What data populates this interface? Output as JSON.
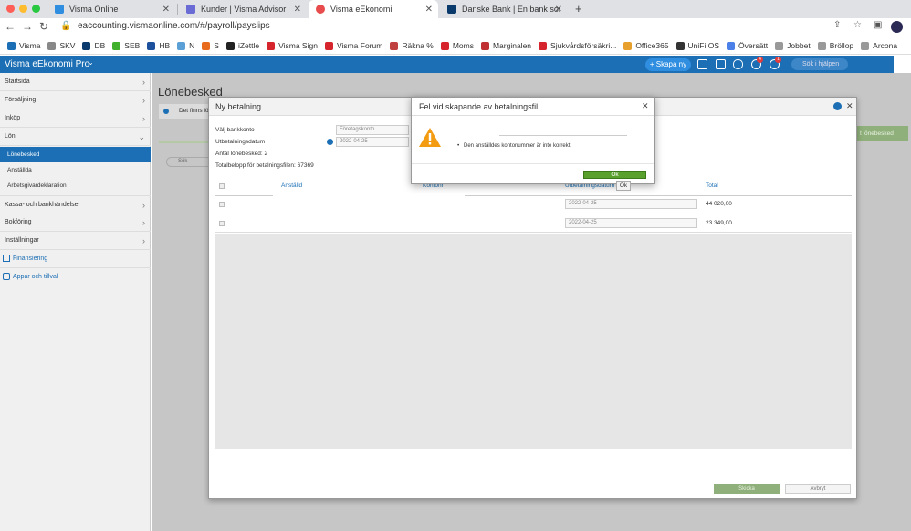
{
  "browser": {
    "tabs": [
      {
        "title": "Visma Online",
        "color": "#2f8ee0"
      },
      {
        "title": "Kunder | Visma Advisor",
        "color": "#6b6bd6"
      },
      {
        "title": "Visma eEkonomi",
        "color": "#e84b4b"
      },
      {
        "title": "Danske Bank | En bank som gö",
        "color": "#0a3a6b"
      }
    ],
    "new_tab": "+",
    "url": "eaccounting.vismaonline.com/#/payroll/payslips",
    "bookmarks": [
      {
        "label": "Visma",
        "color": "#1c6fb4"
      },
      {
        "label": "SKV",
        "color": "#888888"
      },
      {
        "label": "DB",
        "color": "#0a3a6b"
      },
      {
        "label": "SEB",
        "color": "#41b02c"
      },
      {
        "label": "HB",
        "color": "#1c4f9c"
      },
      {
        "label": "N",
        "color": "#5aa0d6"
      },
      {
        "label": "S",
        "color": "#e86b1c"
      },
      {
        "label": "iZettle",
        "color": "#222222"
      },
      {
        "label": "Visma Sign",
        "color": "#d6242c"
      },
      {
        "label": "Visma Forum",
        "color": "#d6242c"
      },
      {
        "label": "Räkna %",
        "color": "#c04040"
      },
      {
        "label": "Moms",
        "color": "#d6242c"
      },
      {
        "label": "Marginalen",
        "color": "#c03030"
      },
      {
        "label": "Sjukvårdsförsäkri...",
        "color": "#d6242c"
      },
      {
        "label": "Office365",
        "color": "#e8a02c"
      },
      {
        "label": "UniFi OS",
        "color": "#333333"
      },
      {
        "label": "Översätt",
        "color": "#4a80e8"
      },
      {
        "label": "Jobbet",
        "color": "#999999"
      },
      {
        "label": "Bröllop",
        "color": "#999999"
      },
      {
        "label": "Arcona",
        "color": "#999999"
      }
    ]
  },
  "app": {
    "brand": "Visma eEkonomi Pro",
    "create_button": "+ Skapa ny",
    "search_placeholder": "Sök i hjälpen",
    "badge_a": "4",
    "badge_b": "1"
  },
  "sidebar": {
    "items": [
      {
        "label": "Startsida"
      },
      {
        "label": "Försäljning"
      },
      {
        "label": "Inköp"
      },
      {
        "label": "Lön"
      }
    ],
    "lon_sub": [
      "Lönebesked",
      "Anställda",
      "Arbetsgivardeklaration"
    ],
    "items2": [
      {
        "label": "Kassa- och bankhändelser"
      },
      {
        "label": "Bokföring"
      },
      {
        "label": "Inställningar"
      }
    ],
    "financing": "Finansiering",
    "apps": "Appar och tillval"
  },
  "page": {
    "title": "Lönebesked",
    "info_text": "Det finns lö",
    "search_placeholder": "Sök",
    "right_button": "t lönebesked"
  },
  "payment_modal": {
    "title": "Ny betalning",
    "bank_label": "Välj bankkonto",
    "bank_value": "Företagskonto",
    "date_label": "Utbetalningsdatum",
    "date_value": "2022-04-25",
    "count_label": "Antal lönebesked: 2",
    "total_label": "Totalbelopp för betalningsfilen: 67369",
    "columns": [
      "Anställd",
      "Kontonr",
      "Utbetalningsdatum",
      "Total"
    ],
    "rows": [
      {
        "date": "2022-04-25",
        "total": "44 020,00"
      },
      {
        "date": "2022-04-25",
        "total": "23 349,00"
      }
    ],
    "send_button": "Skicka",
    "cancel_button": "Avbryt"
  },
  "error_dialog": {
    "title": "Fel vid skapande av betalningsfil",
    "message": "Den anställdes kontonummer är inte korrekt.",
    "ok_button": "Ok",
    "tooltip": "Ok"
  }
}
